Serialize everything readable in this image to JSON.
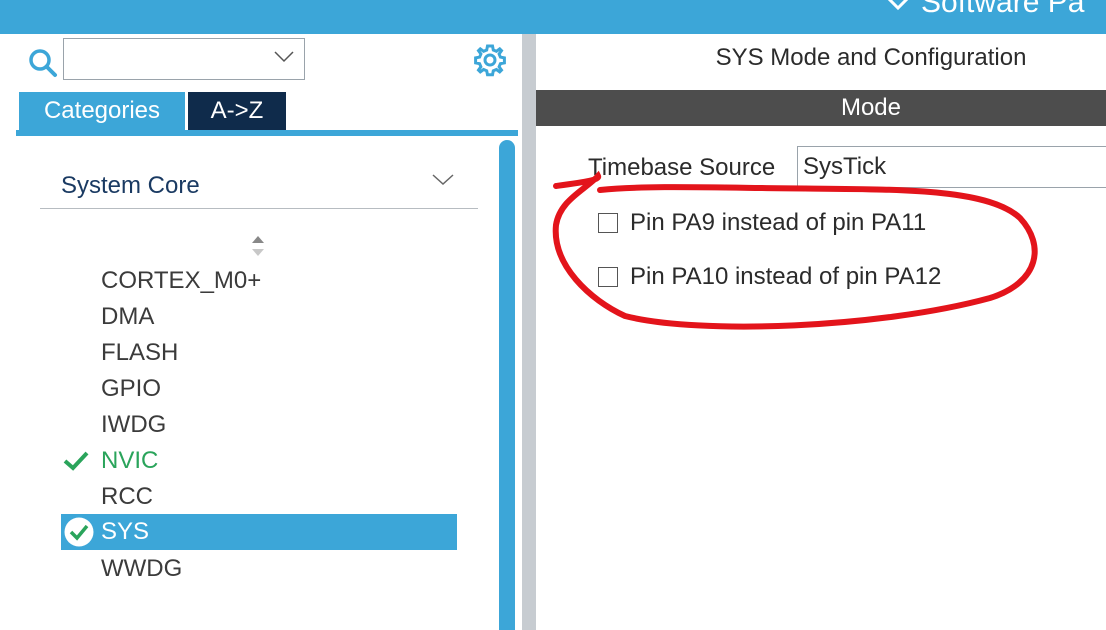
{
  "header": {
    "title": "Software Pa"
  },
  "left_panel": {
    "search": {
      "value": "",
      "placeholder": ""
    },
    "tabs": [
      {
        "label": "Categories",
        "active": true
      },
      {
        "label": "A->Z",
        "active": false
      }
    ],
    "category_dropdown": {
      "label": "System Core"
    },
    "items": [
      {
        "label": "CORTEX_M0+",
        "state": "normal"
      },
      {
        "label": "DMA",
        "state": "normal"
      },
      {
        "label": "FLASH",
        "state": "normal"
      },
      {
        "label": "GPIO",
        "state": "normal"
      },
      {
        "label": "IWDG",
        "state": "normal"
      },
      {
        "label": "NVIC",
        "state": "enabled"
      },
      {
        "label": "RCC",
        "state": "normal"
      },
      {
        "label": "SYS",
        "state": "selected"
      },
      {
        "label": "WWDG",
        "state": "normal"
      }
    ]
  },
  "right_panel": {
    "title": "SYS Mode and Configuration",
    "section": "Mode",
    "timebase": {
      "label": "Timebase Source",
      "value": "SysTick"
    },
    "checkboxes": [
      {
        "label": "Pin PA9 instead of pin PA11",
        "checked": false
      },
      {
        "label": "Pin PA10 instead of pin PA12",
        "checked": false
      }
    ]
  },
  "colors": {
    "accent": "#3ca6d8",
    "dark_tab": "#0f2b4b",
    "mode_bar": "#4d4d4d",
    "enabled": "#2aa45b",
    "annotation": "#e3141b"
  },
  "icons": {
    "search": "search-icon",
    "gear": "gear-icon",
    "dropdown": "chevron-down-icon",
    "sort": "sort-icon",
    "check": "check-icon"
  }
}
